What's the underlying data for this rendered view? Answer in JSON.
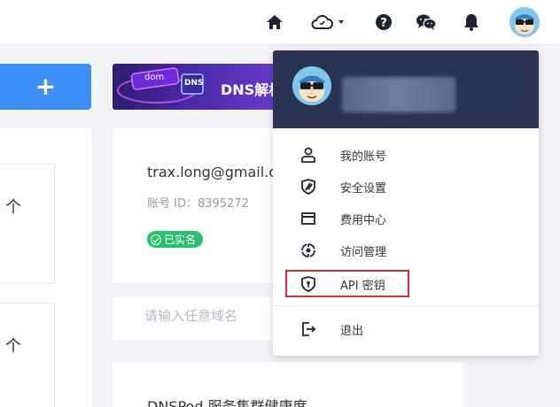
{
  "header": {
    "icons": [
      "home-icon",
      "cloud-icon",
      "help-icon",
      "wechat-icon",
      "bell-icon",
      "avatar"
    ],
    "accent": "#3e8ef7"
  },
  "left": {
    "add_label": "+",
    "boxes": [
      {
        "text": "个"
      },
      {
        "text": "个"
      }
    ]
  },
  "banner": {
    "chip1": "dom",
    "chip2": "DNS",
    "text": "DNS解析"
  },
  "account": {
    "email": "trax.long@gmail.c",
    "id_label": "账号 ID：8395272",
    "verified": "已实名",
    "verified_color": "#27c06b"
  },
  "search": {
    "placeholder": "请输入任意域名"
  },
  "health": {
    "title": "DNSPod 服务集群健康度"
  },
  "dropdown": {
    "header_bg": "#2a3452",
    "items": [
      {
        "label": "我的账号",
        "icon": "user-icon"
      },
      {
        "label": "安全设置",
        "icon": "shield-icon"
      },
      {
        "label": "费用中心",
        "icon": "billing-icon"
      },
      {
        "label": "访问管理",
        "icon": "access-icon"
      },
      {
        "label": "API 密钥",
        "icon": "key-shield-icon"
      }
    ],
    "logout": {
      "label": "退出",
      "icon": "logout-icon"
    },
    "highlight_color": "#c8333a"
  }
}
